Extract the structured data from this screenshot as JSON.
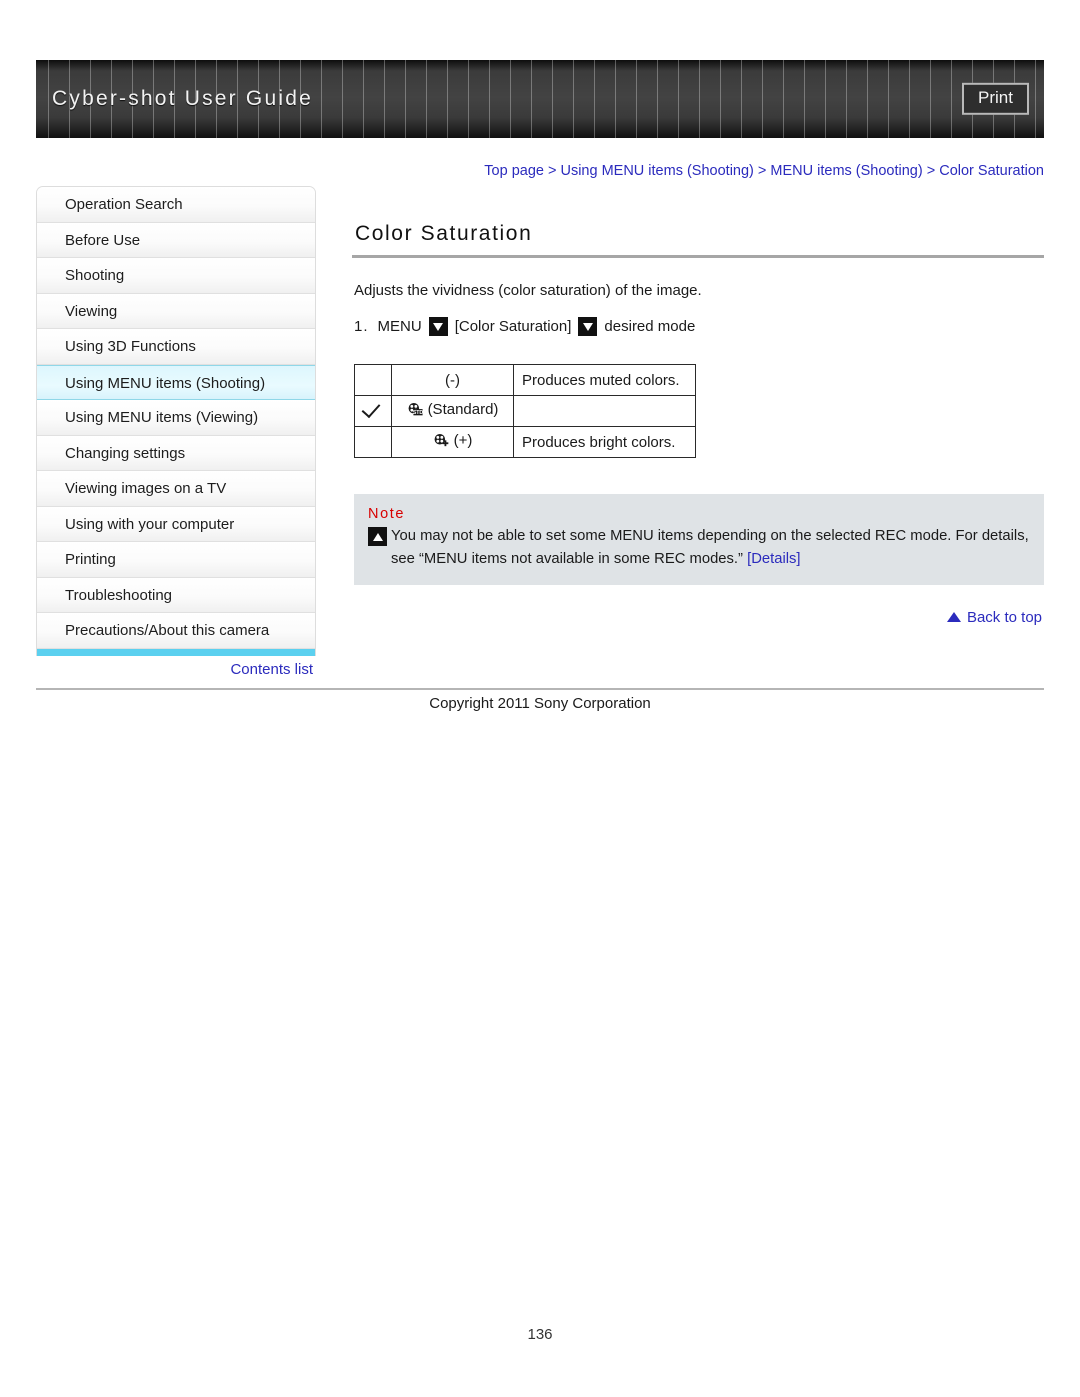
{
  "header": {
    "title": "Cyber-shot User Guide",
    "print_label": "Print"
  },
  "breadcrumb": {
    "full_text": "Top page > Using MENU items (Shooting) > MENU items (Shooting) > Color Saturation",
    "items": [
      "Top page",
      "Using MENU items (Shooting)",
      "MENU items (Shooting)",
      "Color Saturation"
    ]
  },
  "sidebar": {
    "items": [
      {
        "label": "Operation Search",
        "active": false
      },
      {
        "label": "Before Use",
        "active": false
      },
      {
        "label": "Shooting",
        "active": false
      },
      {
        "label": "Viewing",
        "active": false
      },
      {
        "label": "Using 3D Functions",
        "active": false
      },
      {
        "label": "Using MENU items (Shooting)",
        "active": true
      },
      {
        "label": "Using MENU items (Viewing)",
        "active": false
      },
      {
        "label": "Changing settings",
        "active": false
      },
      {
        "label": "Viewing images on a TV",
        "active": false
      },
      {
        "label": "Using with your computer",
        "active": false
      },
      {
        "label": "Printing",
        "active": false
      },
      {
        "label": "Troubleshooting",
        "active": false
      },
      {
        "label": "Precautions/About this camera",
        "active": false
      }
    ],
    "contents_list_label": "Contents list"
  },
  "main": {
    "title": "Color Saturation",
    "lead": "Adjusts the vividness (color saturation) of the image.",
    "step": {
      "number": "1.",
      "part1": "MENU",
      "part2": "[Color Saturation]",
      "part3": "desired mode",
      "icon1": "triangle-down-icon",
      "icon2": "triangle-down-icon"
    },
    "table": {
      "rows": [
        {
          "checked": "",
          "mode": "(-)",
          "mode_icon": "",
          "description": "Produces muted colors."
        },
        {
          "checked": "check-icon",
          "mode": "(Standard)",
          "mode_icon": "saturation-std-icon",
          "description": ""
        },
        {
          "checked": "",
          "mode": "(+)",
          "mode_icon": "saturation-plus-icon",
          "description": "Produces bright colors."
        }
      ]
    },
    "note": {
      "heading": "Note",
      "text": "You may not be able to set some MENU items depending on the selected REC mode. For details, see “MENU items not available in some REC modes.” ",
      "link_label": "[Details]",
      "bullet_icon": "triangle-up-icon"
    },
    "back_to_top": "Back to top"
  },
  "footer": {
    "copyright": "Copyright 2011 Sony Corporation",
    "page_number": "136"
  },
  "colors": {
    "link": "#2b2bbd",
    "note_heading": "#d80000",
    "note_background": "#dfe3e6",
    "sidebar_active": "#ddf6fd",
    "sidebar_accent_bar": "#5bd0ef",
    "header_dark": "#3b3b3b"
  }
}
